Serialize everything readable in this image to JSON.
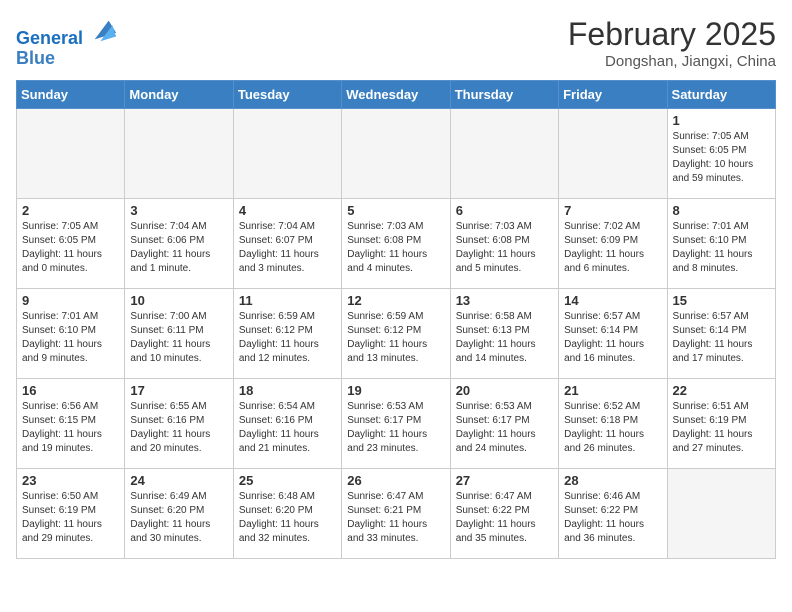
{
  "header": {
    "logo_line1": "General",
    "logo_line2": "Blue",
    "month_title": "February 2025",
    "subtitle": "Dongshan, Jiangxi, China"
  },
  "weekdays": [
    "Sunday",
    "Monday",
    "Tuesday",
    "Wednesday",
    "Thursday",
    "Friday",
    "Saturday"
  ],
  "weeks": [
    [
      {
        "day": "",
        "info": ""
      },
      {
        "day": "",
        "info": ""
      },
      {
        "day": "",
        "info": ""
      },
      {
        "day": "",
        "info": ""
      },
      {
        "day": "",
        "info": ""
      },
      {
        "day": "",
        "info": ""
      },
      {
        "day": "1",
        "info": "Sunrise: 7:05 AM\nSunset: 6:05 PM\nDaylight: 10 hours\nand 59 minutes."
      }
    ],
    [
      {
        "day": "2",
        "info": "Sunrise: 7:05 AM\nSunset: 6:05 PM\nDaylight: 11 hours\nand 0 minutes."
      },
      {
        "day": "3",
        "info": "Sunrise: 7:04 AM\nSunset: 6:06 PM\nDaylight: 11 hours\nand 1 minute."
      },
      {
        "day": "4",
        "info": "Sunrise: 7:04 AM\nSunset: 6:07 PM\nDaylight: 11 hours\nand 3 minutes."
      },
      {
        "day": "5",
        "info": "Sunrise: 7:03 AM\nSunset: 6:08 PM\nDaylight: 11 hours\nand 4 minutes."
      },
      {
        "day": "6",
        "info": "Sunrise: 7:03 AM\nSunset: 6:08 PM\nDaylight: 11 hours\nand 5 minutes."
      },
      {
        "day": "7",
        "info": "Sunrise: 7:02 AM\nSunset: 6:09 PM\nDaylight: 11 hours\nand 6 minutes."
      },
      {
        "day": "8",
        "info": "Sunrise: 7:01 AM\nSunset: 6:10 PM\nDaylight: 11 hours\nand 8 minutes."
      }
    ],
    [
      {
        "day": "9",
        "info": "Sunrise: 7:01 AM\nSunset: 6:10 PM\nDaylight: 11 hours\nand 9 minutes."
      },
      {
        "day": "10",
        "info": "Sunrise: 7:00 AM\nSunset: 6:11 PM\nDaylight: 11 hours\nand 10 minutes."
      },
      {
        "day": "11",
        "info": "Sunrise: 6:59 AM\nSunset: 6:12 PM\nDaylight: 11 hours\nand 12 minutes."
      },
      {
        "day": "12",
        "info": "Sunrise: 6:59 AM\nSunset: 6:12 PM\nDaylight: 11 hours\nand 13 minutes."
      },
      {
        "day": "13",
        "info": "Sunrise: 6:58 AM\nSunset: 6:13 PM\nDaylight: 11 hours\nand 14 minutes."
      },
      {
        "day": "14",
        "info": "Sunrise: 6:57 AM\nSunset: 6:14 PM\nDaylight: 11 hours\nand 16 minutes."
      },
      {
        "day": "15",
        "info": "Sunrise: 6:57 AM\nSunset: 6:14 PM\nDaylight: 11 hours\nand 17 minutes."
      }
    ],
    [
      {
        "day": "16",
        "info": "Sunrise: 6:56 AM\nSunset: 6:15 PM\nDaylight: 11 hours\nand 19 minutes."
      },
      {
        "day": "17",
        "info": "Sunrise: 6:55 AM\nSunset: 6:16 PM\nDaylight: 11 hours\nand 20 minutes."
      },
      {
        "day": "18",
        "info": "Sunrise: 6:54 AM\nSunset: 6:16 PM\nDaylight: 11 hours\nand 21 minutes."
      },
      {
        "day": "19",
        "info": "Sunrise: 6:53 AM\nSunset: 6:17 PM\nDaylight: 11 hours\nand 23 minutes."
      },
      {
        "day": "20",
        "info": "Sunrise: 6:53 AM\nSunset: 6:17 PM\nDaylight: 11 hours\nand 24 minutes."
      },
      {
        "day": "21",
        "info": "Sunrise: 6:52 AM\nSunset: 6:18 PM\nDaylight: 11 hours\nand 26 minutes."
      },
      {
        "day": "22",
        "info": "Sunrise: 6:51 AM\nSunset: 6:19 PM\nDaylight: 11 hours\nand 27 minutes."
      }
    ],
    [
      {
        "day": "23",
        "info": "Sunrise: 6:50 AM\nSunset: 6:19 PM\nDaylight: 11 hours\nand 29 minutes."
      },
      {
        "day": "24",
        "info": "Sunrise: 6:49 AM\nSunset: 6:20 PM\nDaylight: 11 hours\nand 30 minutes."
      },
      {
        "day": "25",
        "info": "Sunrise: 6:48 AM\nSunset: 6:20 PM\nDaylight: 11 hours\nand 32 minutes."
      },
      {
        "day": "26",
        "info": "Sunrise: 6:47 AM\nSunset: 6:21 PM\nDaylight: 11 hours\nand 33 minutes."
      },
      {
        "day": "27",
        "info": "Sunrise: 6:47 AM\nSunset: 6:22 PM\nDaylight: 11 hours\nand 35 minutes."
      },
      {
        "day": "28",
        "info": "Sunrise: 6:46 AM\nSunset: 6:22 PM\nDaylight: 11 hours\nand 36 minutes."
      },
      {
        "day": "",
        "info": ""
      }
    ]
  ]
}
